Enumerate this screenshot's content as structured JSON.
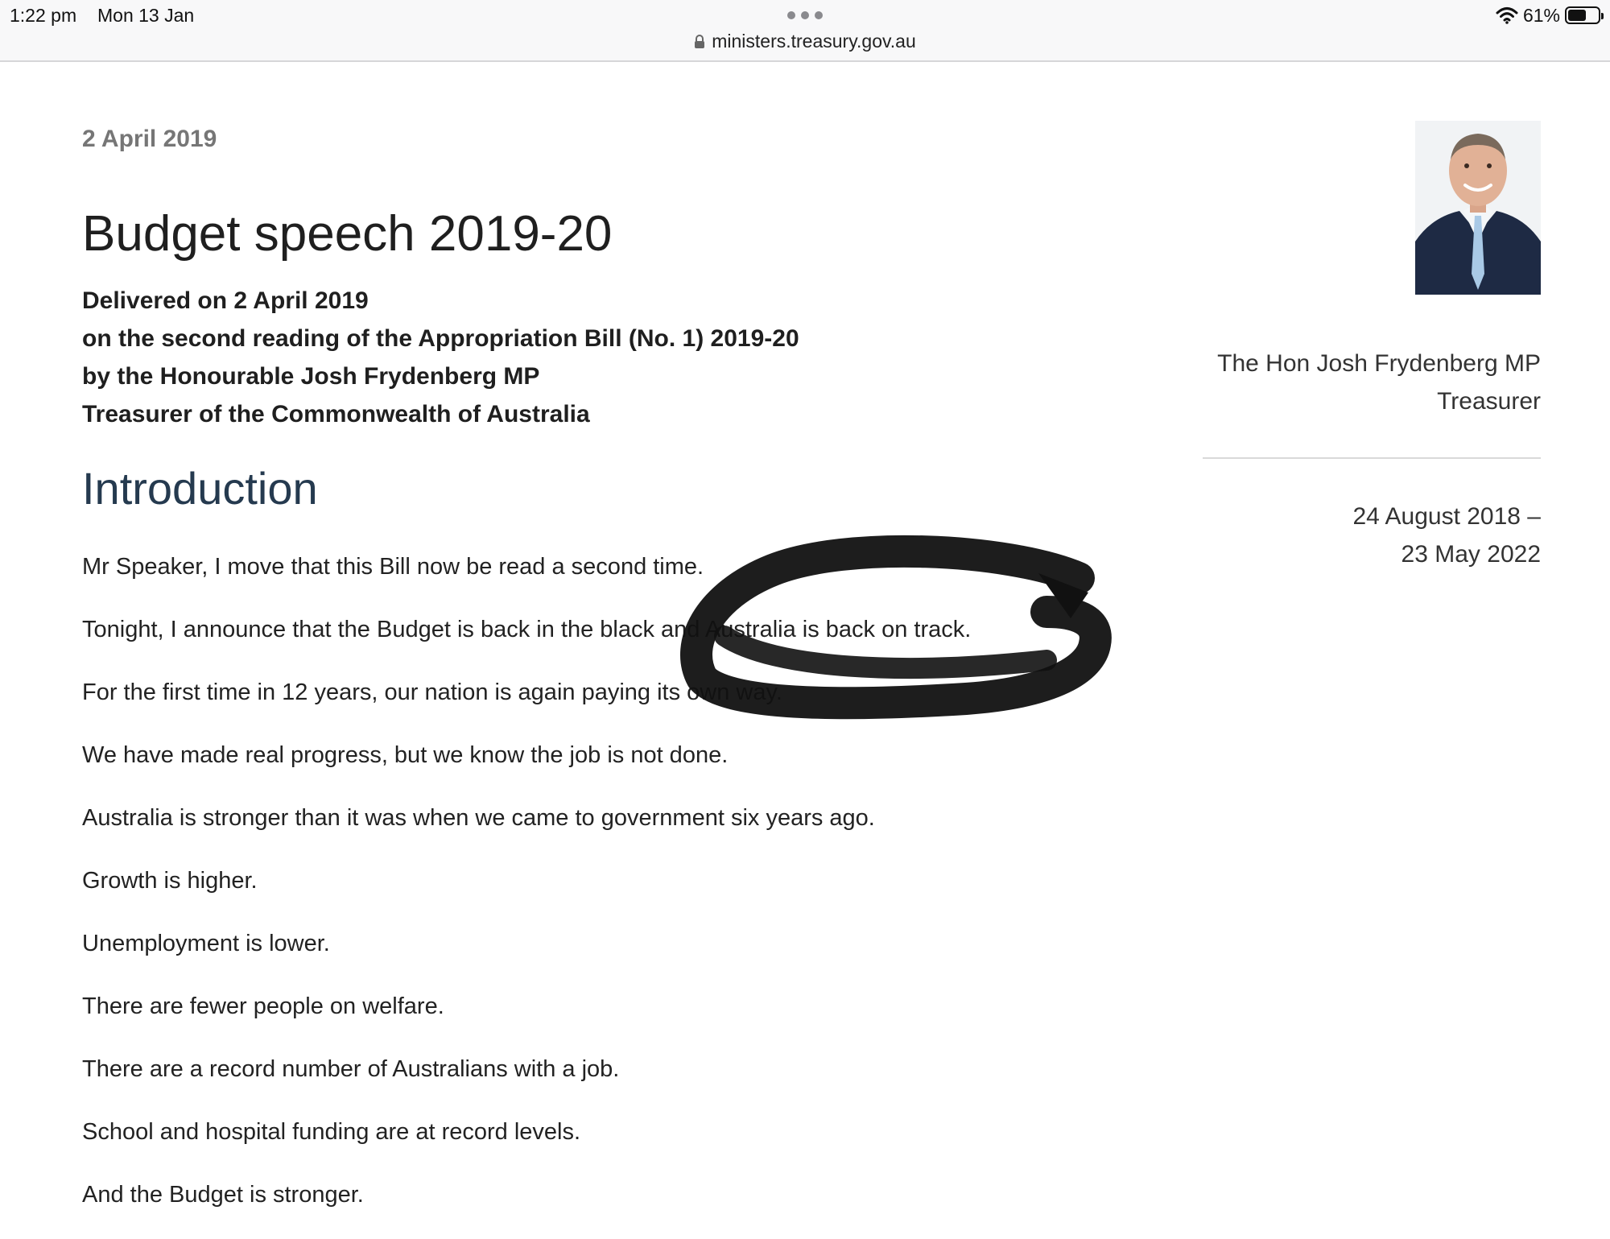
{
  "status_bar": {
    "time": "1:22 pm",
    "date": "Mon 13 Jan",
    "url": "ministers.treasury.gov.au",
    "battery": "61%",
    "battery_level": 0.61
  },
  "article": {
    "date": "2 April 2019",
    "title": "Budget speech 2019-20",
    "delivered_lines": [
      "Delivered on 2 April 2019",
      "on the second reading of the Appropriation Bill (No. 1) 2019-20",
      "by the Honourable Josh Frydenberg MP",
      "Treasurer of the Commonwealth of Australia"
    ],
    "section_heading": "Introduction",
    "paragraphs": [
      "Mr Speaker, I move that this Bill now be read a second time.",
      "Tonight, I announce that the Budget is back in the black and Australia is back on track.",
      "For the first time in 12 years, our nation is again paying its own way.",
      "We have made real progress, but we know the job is not done.",
      "Australia is stronger than it was when we came to government six years ago.",
      "Growth is higher.",
      "Unemployment is lower.",
      "There are fewer people on welfare.",
      "There are a record number of Australians with a job.",
      "School and hospital funding are at record levels.",
      "And the Budget is stronger."
    ]
  },
  "sidebar": {
    "minister_name": "The Hon Josh Frydenberg MP",
    "minister_role": "Treasurer",
    "term_start": "24 August 2018 –",
    "term_end": "23 May 2022"
  },
  "colors": {
    "heading_blue": "#253a4f",
    "date_grey": "#767676",
    "ink": "#111111"
  }
}
